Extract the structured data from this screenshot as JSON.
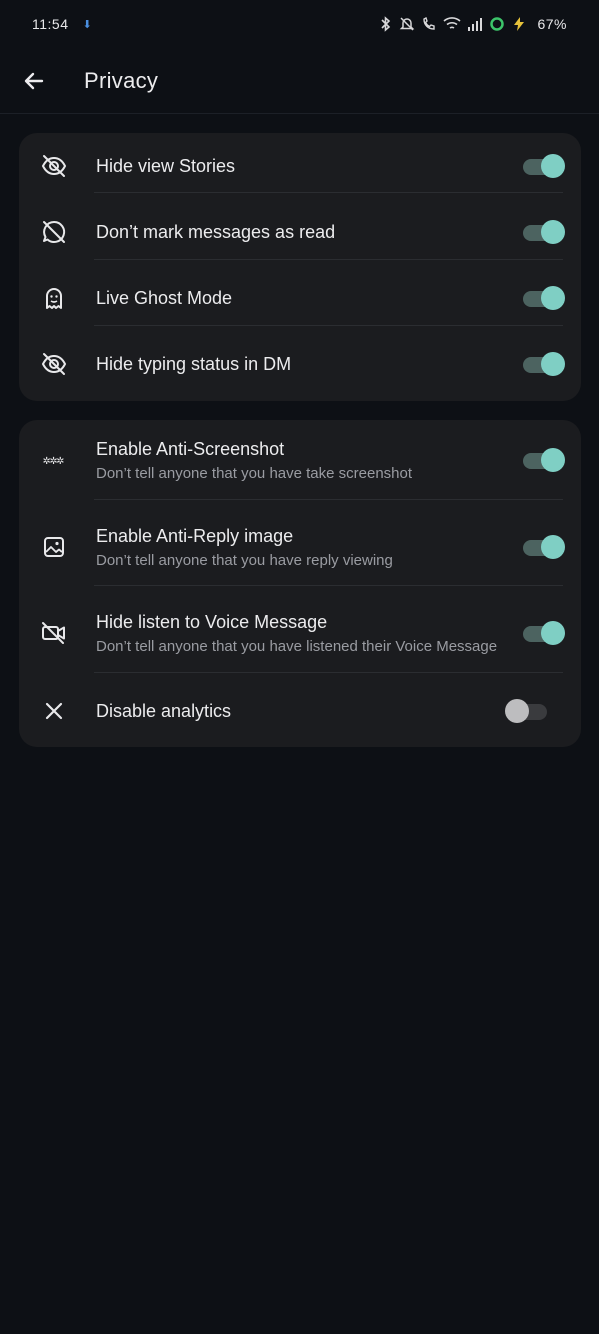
{
  "status_bar": {
    "time": "11:54",
    "battery": "67%"
  },
  "header": {
    "title": "Privacy"
  },
  "section1": {
    "items": [
      {
        "label": "Hide view Stories",
        "icon": "eye-off-icon",
        "enabled": true
      },
      {
        "label": "Don’t mark messages as read",
        "icon": "message-off-icon",
        "enabled": true
      },
      {
        "label": "Live Ghost Mode",
        "icon": "ghost-icon",
        "enabled": true
      },
      {
        "label": "Hide typing status in DM",
        "icon": "eye-off-icon",
        "enabled": true
      }
    ]
  },
  "section2": {
    "items": [
      {
        "label": "Enable Anti-Screenshot",
        "sub": "Don’t tell anyone that you have take screenshot",
        "icon": "asterisks-icon",
        "enabled": true
      },
      {
        "label": "Enable Anti-Reply image",
        "sub": "Don’t tell anyone that you have reply viewing",
        "icon": "image-icon",
        "enabled": true
      },
      {
        "label": "Hide listen to Voice Message",
        "sub": "Don’t tell anyone that you have listened their Voice Message",
        "icon": "video-off-icon",
        "enabled": true
      },
      {
        "label": "Disable analytics",
        "icon": "close-icon",
        "enabled": false
      }
    ]
  },
  "colors": {
    "background": "#0d1015",
    "card": "#1b1c1f",
    "toggle_on_thumb": "#7fcfc4",
    "toggle_on_track": "#4c6360",
    "toggle_off_thumb": "#bdbdbf"
  }
}
